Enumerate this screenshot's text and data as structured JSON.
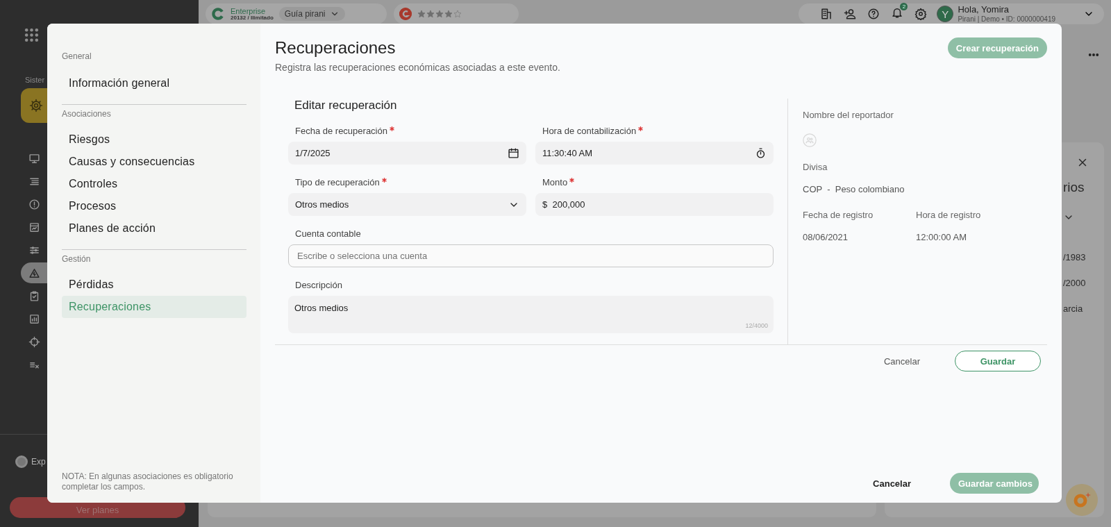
{
  "sidebar": {
    "section_label": "Sister",
    "nav_icons": [
      {
        "selected": false
      },
      {
        "selected": false
      },
      {
        "selected": false
      },
      {
        "selected": false
      },
      {
        "selected": false
      },
      {
        "selected": true
      },
      {
        "selected": false
      },
      {
        "selected": false
      },
      {
        "selected": false
      },
      {
        "selected": false
      }
    ],
    "footer_label": "Exp",
    "plans_button": "Ver planes"
  },
  "topbar": {
    "plan": "Enterprise",
    "license": "20132 / Ilimitado",
    "guide": "Guía pirani",
    "rating": {
      "stars": 4
    },
    "notifications": "2",
    "user": {
      "initial": "Y",
      "greeting": "Hola, Yomira",
      "details": "Pirani | Demo • ID: 0000000419"
    }
  },
  "background_panel": {
    "title": "rios",
    "rows": [
      "/1983",
      "/2000",
      "arcia"
    ]
  },
  "modal": {
    "nav": {
      "sections": [
        {
          "title": "General",
          "items": [
            {
              "label": "Información general",
              "selected": false
            }
          ]
        },
        {
          "title": "Asociaciones",
          "items": [
            {
              "label": "Riesgos",
              "selected": false
            },
            {
              "label": "Causas y consecuencias",
              "selected": false
            },
            {
              "label": "Controles",
              "selected": false
            },
            {
              "label": "Procesos",
              "selected": false
            },
            {
              "label": "Planes de acción",
              "selected": false
            }
          ]
        },
        {
          "title": "Gestión",
          "items": [
            {
              "label": "Pérdidas",
              "selected": false
            },
            {
              "label": "Recuperaciones",
              "selected": true
            }
          ]
        }
      ],
      "note": "NOTA: En algunas asociaciones es obligatorio completar los campos."
    },
    "header": {
      "title": "Recuperaciones",
      "subtitle": "Registra las recuperaciones económicas asociadas a este evento.",
      "create_button": {
        "label": "Crear recuperación",
        "disabled": true
      }
    },
    "form": {
      "title": "Editar recuperación",
      "fields": [
        {
          "kind": "date",
          "label": "Fecha de recuperación",
          "required": true,
          "value": "1/7/2025"
        },
        {
          "kind": "time",
          "label": "Hora de contabilización",
          "required": true,
          "value": "11:30:40 AM"
        },
        {
          "kind": "select",
          "label": "Tipo de recuperación",
          "required": true,
          "value": "Otros medios"
        },
        {
          "kind": "currency",
          "label": "Monto",
          "required": true,
          "prefix": "$",
          "value": "200,000"
        },
        {
          "kind": "account",
          "label": "Cuenta contable",
          "required": false,
          "placeholder": "Escribe o selecciona una cuenta"
        },
        {
          "kind": "textarea",
          "label": "Descripción",
          "required": false,
          "value": "Otros medios",
          "counter": "12/4000"
        }
      ]
    },
    "info": {
      "reporter_label": "Nombre del reportador",
      "currency_label": "Divisa",
      "currency": "COP  -  Peso colombiano",
      "fields": [
        {
          "label": "Fecha de registro",
          "value": "08/06/2021"
        },
        {
          "label": "Hora de registro",
          "value": "12:00:00 AM"
        }
      ]
    },
    "form_actions": {
      "cancel": "Cancelar",
      "save": "Guardar"
    },
    "footer": {
      "cancel": "Cancelar",
      "save": {
        "label": "Guardar cambios",
        "disabled": true
      }
    }
  }
}
